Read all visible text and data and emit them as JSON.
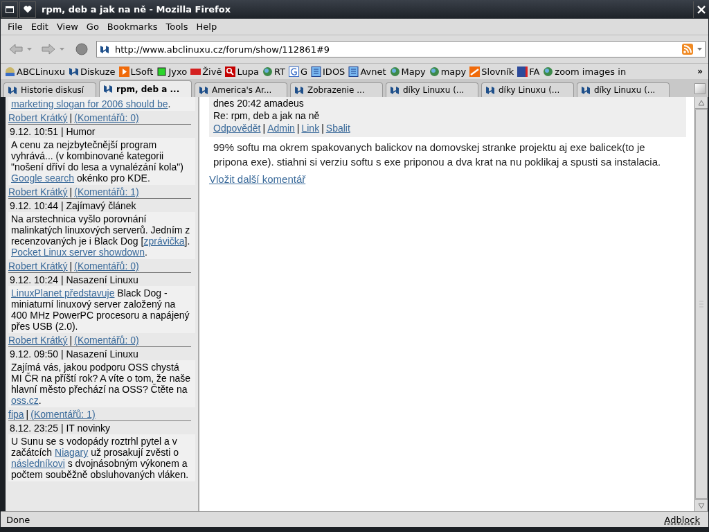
{
  "window": {
    "title": "rpm, deb a jak na ně - Mozilla Firefox"
  },
  "menu": [
    "File",
    "Edit",
    "View",
    "Go",
    "Bookmarks",
    "Tools",
    "Help"
  ],
  "address": {
    "value": "http://www.abclinuxu.cz/forum/show/112861#9"
  },
  "bookmarks": [
    "ABCLinuxu",
    "Diskuze",
    "LSoft",
    "Jyxo",
    "Živě",
    "Lupa",
    "RT",
    "G",
    "IDOS",
    "Avnet",
    "Mapy",
    "mapy",
    "Slovník",
    "FA",
    "zoom images in"
  ],
  "bookmarks_more": "»",
  "tabs": [
    {
      "label": "Historie diskusí",
      "selected": false
    },
    {
      "label": "rpm, deb a ...",
      "selected": true
    },
    {
      "label": "America's Ar...",
      "selected": false
    },
    {
      "label": "Zobrazenie ...",
      "selected": false
    },
    {
      "label": "díky Linuxu (...",
      "selected": false
    },
    {
      "label": "díky Linuxu (...",
      "selected": false
    },
    {
      "label": "díky Linuxu (...",
      "selected": false
    }
  ],
  "sidebar": {
    "entries": [
      {
        "body": [
          {
            "text": "marketing slogan for 2006 should be",
            "link": true
          },
          {
            "text": ".",
            "link": false
          }
        ],
        "footer": [
          {
            "text": "Robert Krátký",
            "link": true
          },
          {
            "text": "|",
            "link": false
          },
          {
            "text": "(Komentářů: 0)",
            "link": true
          }
        ]
      },
      {
        "heading": "9.12. 10:51 | Humor",
        "body": [
          {
            "text": "A cenu za nejzbytečnější program vyhrává... (v kombinované kategorii \"nošení dříví do lesa a vynalézání kola\") ",
            "link": false
          },
          {
            "text": "Google search",
            "link": true
          },
          {
            "text": " okénko pro KDE.",
            "link": false
          }
        ],
        "footer": [
          {
            "text": "Robert Krátký",
            "link": true
          },
          {
            "text": "|",
            "link": false
          },
          {
            "text": "(Komentářů: 1)",
            "link": true
          }
        ]
      },
      {
        "heading": "9.12. 10:44 | Zajímavý článek",
        "body": [
          {
            "text": "Na arstechnica vyšlo porovnání malinkatých linuxových serverů. Jedním z recenzovaných je i Black Dog [",
            "link": false
          },
          {
            "text": "zprávička",
            "link": true
          },
          {
            "text": "]. ",
            "link": false
          },
          {
            "text": "Pocket Linux server showdown",
            "link": true
          },
          {
            "text": ".",
            "link": false
          }
        ],
        "footer": [
          {
            "text": "Robert Krátký",
            "link": true
          },
          {
            "text": "|",
            "link": false
          },
          {
            "text": "(Komentářů: 0)",
            "link": true
          }
        ]
      },
      {
        "heading": "9.12. 10:24 | Nasazení Linuxu",
        "body": [
          {
            "text": "LinuxPlanet představuje",
            "link": true
          },
          {
            "text": " Black Dog - miniaturní linuxový server založený na 400 MHz PowerPC procesoru a napájený přes USB (2.0).",
            "link": false
          }
        ],
        "footer": [
          {
            "text": "Robert Krátký",
            "link": true
          },
          {
            "text": "|",
            "link": false
          },
          {
            "text": "(Komentářů: 0)",
            "link": true
          }
        ]
      },
      {
        "heading": "9.12. 09:50 | Nasazení Linuxu",
        "body": [
          {
            "text": "Zajímá vás, jakou podporu OSS chystá MI ČR na příští rok? A víte o tom, že naše hlavní město přechází na OSS? Čtěte na ",
            "link": false
          },
          {
            "text": "oss.cz",
            "link": true
          },
          {
            "text": ".",
            "link": false
          }
        ],
        "footer": [
          {
            "text": "fipa",
            "link": true
          },
          {
            "text": "|",
            "link": false
          },
          {
            "text": "(Komentářů: 1)",
            "link": true
          }
        ]
      },
      {
        "heading": "8.12. 23:25 | IT novinky",
        "body": [
          {
            "text": "U Sunu se s vodopády roztrhl pytel a v začátcích ",
            "link": false
          },
          {
            "text": "Niagary",
            "link": true
          },
          {
            "text": " už prosakují zvěsti o ",
            "link": false
          },
          {
            "text": "následníkovi",
            "link": true
          },
          {
            "text": " s dvojnásobným výkonem a počtem souběžně obsluhovaných vláken.",
            "link": false
          }
        ]
      }
    ]
  },
  "comment": {
    "meta": "dnes 20:42 amadeus",
    "subject": "Re: rpm, deb a jak na ně",
    "actions": [
      {
        "text": "Odpovědět",
        "link": true
      },
      {
        "text": "|",
        "link": false
      },
      {
        "text": "Admin",
        "link": true
      },
      {
        "text": "|",
        "link": false
      },
      {
        "text": "Link",
        "link": true
      },
      {
        "text": "|",
        "link": false
      },
      {
        "text": "Sbalit",
        "link": true
      }
    ],
    "text": "99% softu ma okrem spakovanych balickov na domovskej stranke projektu aj exe balicek(to je pripona exe). stiahni si verziu softu s exe priponou a dva krat na nu poklikaj a spusti sa instalacia."
  },
  "add_comment": "Vložit další komentář",
  "status_bar": {
    "text": "Done",
    "adblock": "Adblock"
  }
}
